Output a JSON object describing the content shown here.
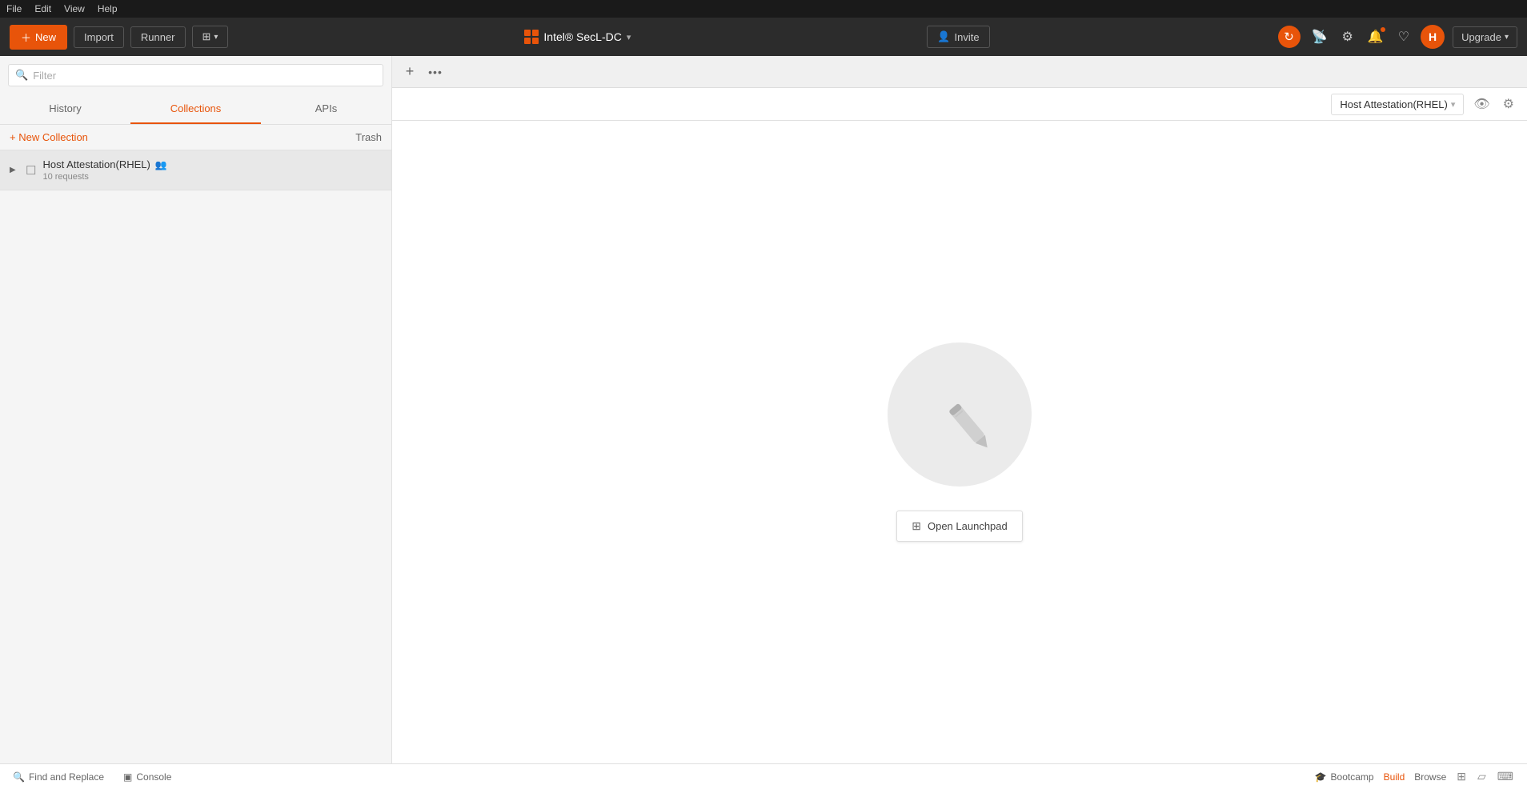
{
  "menubar": {
    "file": "File",
    "edit": "Edit",
    "view": "View",
    "help": "Help"
  },
  "toolbar": {
    "new_label": "New",
    "import_label": "Import",
    "runner_label": "Runner",
    "workspace_name": "Intel® SecL-DC",
    "invite_label": "Invite",
    "upgrade_label": "Upgrade",
    "avatar_initial": "H"
  },
  "sidebar": {
    "search_placeholder": "Filter",
    "tabs": [
      {
        "id": "history",
        "label": "History"
      },
      {
        "id": "collections",
        "label": "Collections"
      },
      {
        "id": "apis",
        "label": "APIs"
      }
    ],
    "active_tab": "collections",
    "new_collection_label": "+ New Collection",
    "trash_label": "Trash",
    "collections": [
      {
        "name": "Host Attestation(RHEL)",
        "meta": "10 requests",
        "team": true
      }
    ]
  },
  "address_bar": {
    "env_selector": "Host Attestation(RHEL)"
  },
  "center": {
    "open_launchpad_label": "Open Launchpad"
  },
  "statusbar": {
    "find_replace_label": "Find and Replace",
    "console_label": "Console",
    "bootcamp_label": "Bootcamp",
    "build_label": "Build",
    "browse_label": "Browse"
  }
}
